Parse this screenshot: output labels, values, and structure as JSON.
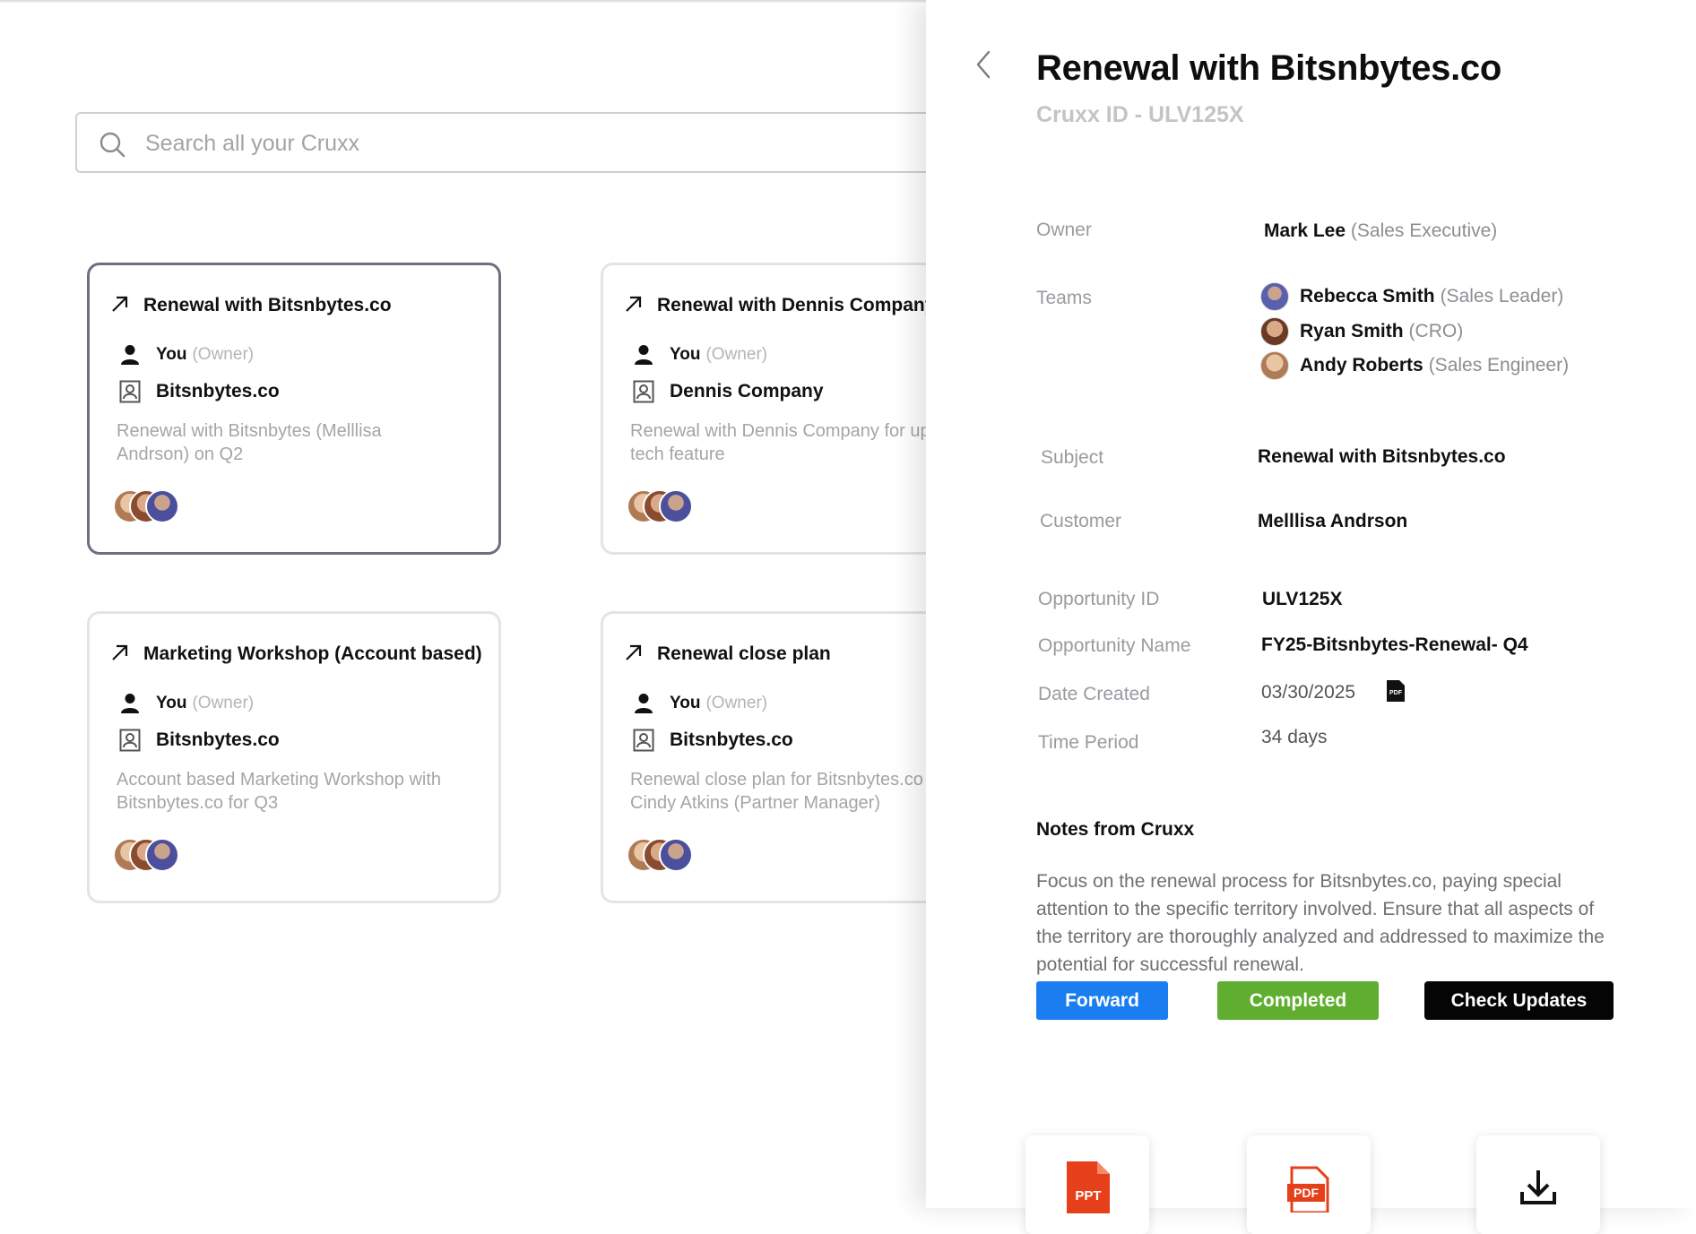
{
  "search": {
    "placeholder": "Search all your Cruxx"
  },
  "cards": [
    {
      "title": "Renewal with Bitsnbytes.co",
      "owner": "You",
      "owner_role": "(Owner)",
      "company": "Bitsnbytes.co",
      "description": "Renewal with Bitsnbytes (Melllisa Andrson) on Q2"
    },
    {
      "title": "Renewal with Dennis Company",
      "owner": "You",
      "owner_role": "(Owner)",
      "company": "Dennis Company",
      "description": "Renewal with Dennis Company for upsell tech feature"
    },
    {
      "title": "Marketing Workshop (Account based)",
      "owner": "You",
      "owner_role": "(Owner)",
      "company": "Bitsnbytes.co",
      "description": "Account based Marketing Workshop with Bitsnbytes.co for Q3"
    },
    {
      "title": "Renewal close plan",
      "owner": "You",
      "owner_role": "(Owner)",
      "company": "Bitsnbytes.co",
      "description": "Renewal close plan for Bitsnbytes.co with Cindy Atkins (Partner Manager)"
    }
  ],
  "detail": {
    "title": "Renewal with Bitsnbytes.co",
    "cruxx_id": "Cruxx ID - ULV125X",
    "owner_label": "Owner",
    "owner_name": "Mark Lee",
    "owner_role": "(Sales Executive)",
    "teams_label": "Teams",
    "teams": [
      {
        "name": "Rebecca Smith",
        "role": "(Sales Leader)"
      },
      {
        "name": "Ryan Smith",
        "role": "(CRO)"
      },
      {
        "name": "Andy Roberts",
        "role": "(Sales Engineer)"
      }
    ],
    "subject_label": "Subject",
    "subject": "Renewal with Bitsnbytes.co",
    "customer_label": "Customer",
    "customer": "Melllisa Andrson",
    "opp_id_label": "Opportunity ID",
    "opp_id": "ULV125X",
    "opp_name_label": "Opportunity Name",
    "opp_name": "FY25-Bitsnbytes-Renewal- Q4",
    "date_label": "Date Created",
    "date": "03/30/2025",
    "period_label": "Time Period",
    "period": "34 days",
    "notes_heading": "Notes from Cruxx",
    "notes": "Focus on the renewal process for Bitsnbytes.co, paying special attention to the specific territory involved. Ensure that all aspects of the territory are thoroughly analyzed and addressed to maximize the potential for successful renewal.",
    "buttons": {
      "forward": "Forward",
      "completed": "Completed",
      "check": "Check Updates"
    },
    "file_tiles": {
      "ppt": "PPT",
      "pdf": "PDF",
      "mini_pdf": "PDF"
    }
  },
  "colors": {
    "forward": "#1a7df0",
    "completed": "#5fae2f",
    "check": "#050505",
    "selected_border": "#6f6d82"
  }
}
